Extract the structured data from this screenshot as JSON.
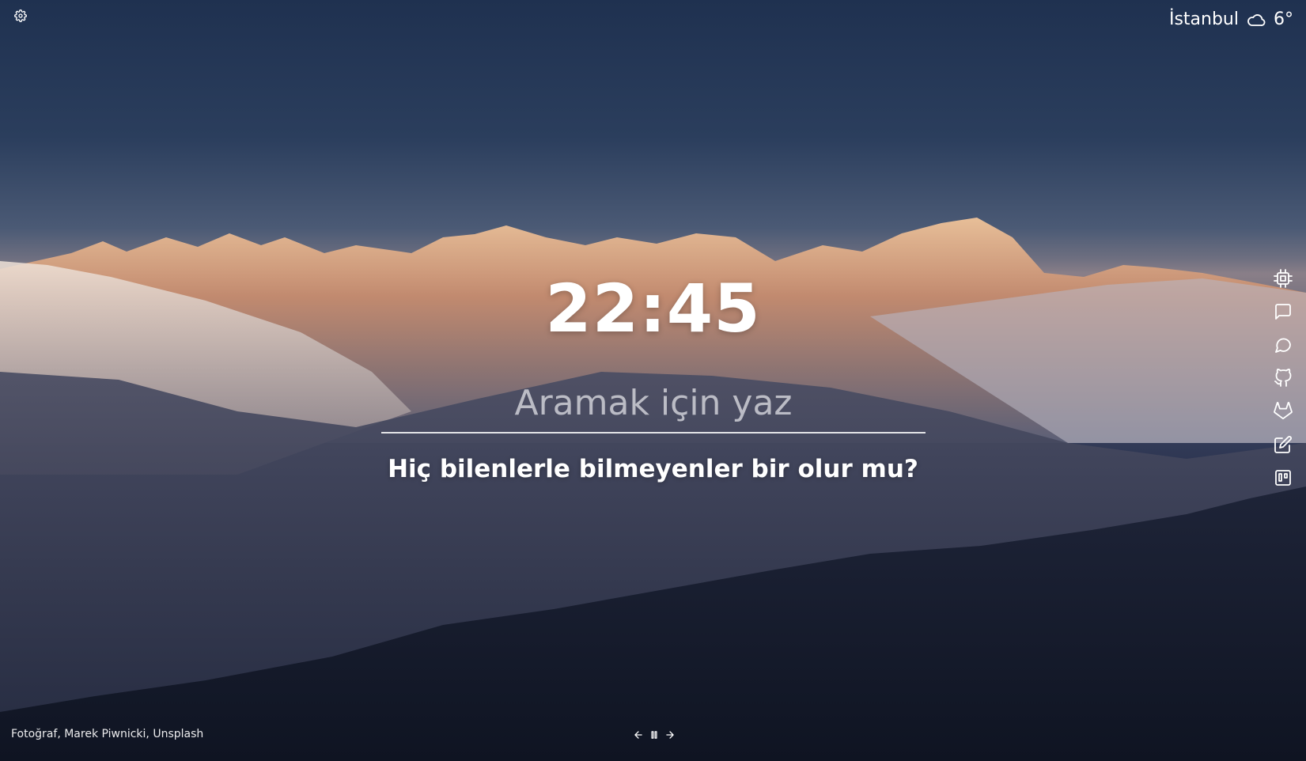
{
  "weather": {
    "city": "İstanbul",
    "temperature": "6°",
    "condition_icon": "cloud-icon"
  },
  "clock": {
    "time": "22:45"
  },
  "search": {
    "placeholder": "Aramak için yaz",
    "value": ""
  },
  "quote": {
    "text": "Hiç bilenlerle bilmeyenler bir olur mu?"
  },
  "sidebar": {
    "items": [
      {
        "icon": "chip-icon"
      },
      {
        "icon": "message-square-icon"
      },
      {
        "icon": "message-circle-icon"
      },
      {
        "icon": "github-icon"
      },
      {
        "icon": "gitlab-icon"
      },
      {
        "icon": "edit-icon"
      },
      {
        "icon": "trello-icon"
      }
    ]
  },
  "background": {
    "credit": "Fotoğraf, Marek Piwnicki, Unsplash"
  },
  "colors": {
    "sky_top": "#1f3150",
    "sunlit_peaks": "#e8a872",
    "forest": "#141a29",
    "text": "#ffffff"
  }
}
